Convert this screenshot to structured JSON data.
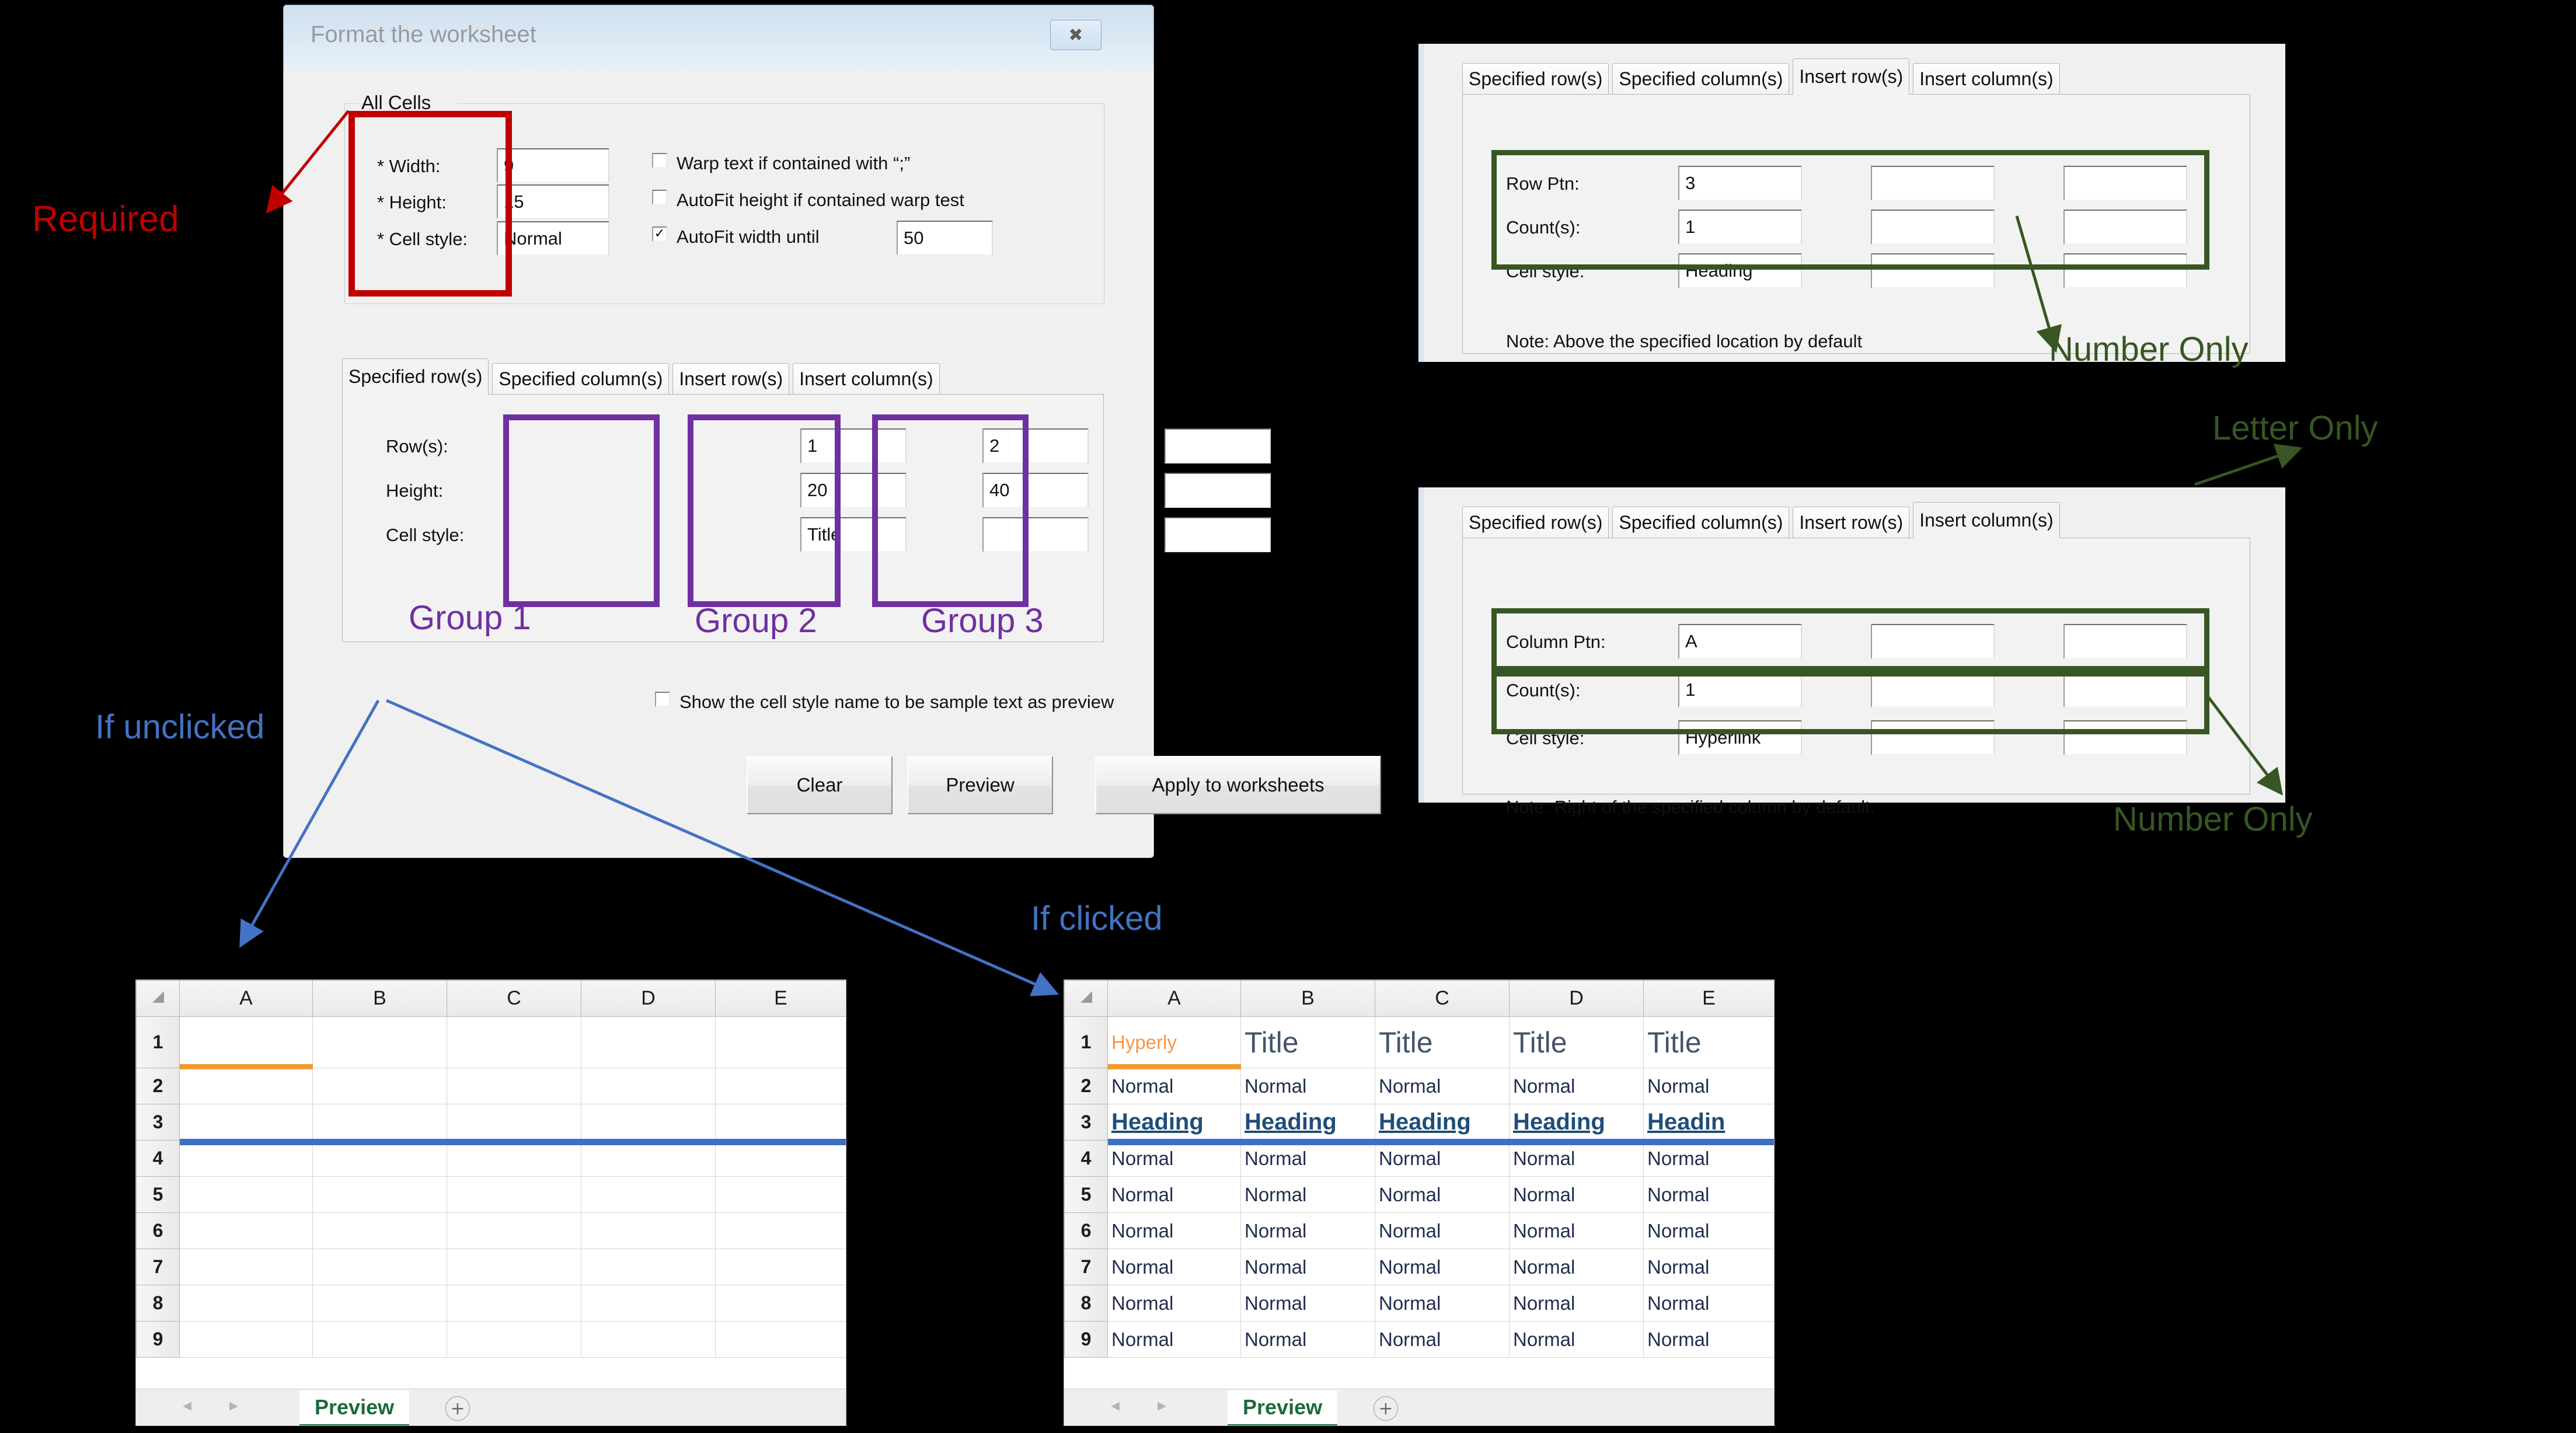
{
  "dialog": {
    "title": "Format the worksheet",
    "close_icon": "close-icon",
    "all_cells": {
      "group_label": "All Cells",
      "fields": [
        {
          "label": "* Width:",
          "value": "9"
        },
        {
          "label": "* Height:",
          "value": "15"
        },
        {
          "label": "* Cell style:",
          "value": "Normal"
        }
      ],
      "checkboxes": [
        {
          "label": "Warp text if contained with “;”",
          "checked": false
        },
        {
          "label": "AutoFit height if contained warp test",
          "checked": false
        },
        {
          "label": "AutoFit width until",
          "checked": true
        }
      ],
      "autofit_width_value": "50"
    },
    "tabs": [
      "Specified row(s)",
      "Specified column(s)",
      "Insert row(s)",
      "Insert column(s)"
    ],
    "active_tab": "Specified row(s)",
    "specified_rows": {
      "row_labels": [
        "Row(s):",
        "Height:",
        "Cell style:"
      ],
      "groups": [
        {
          "name": "Group 1",
          "values": [
            "1",
            "20",
            "Title"
          ]
        },
        {
          "name": "Group 2",
          "values": [
            "2",
            "40",
            ""
          ]
        },
        {
          "name": "Group 3",
          "values": [
            "",
            "",
            ""
          ]
        }
      ]
    },
    "preview_checkbox": {
      "label": "Show the cell style name to be sample text as preview",
      "checked": false
    },
    "buttons": [
      "Clear",
      "Preview",
      "Apply to worksheets"
    ]
  },
  "insert_rows_panel": {
    "tabs": [
      "Specified row(s)",
      "Specified column(s)",
      "Insert row(s)",
      "Insert column(s)"
    ],
    "active_tab": "Insert row(s)",
    "row_labels": [
      "Row Ptn:",
      "Count(s):",
      "Cell style:"
    ],
    "groups": [
      {
        "values": [
          "3",
          "1",
          "Heading"
        ]
      },
      {
        "values": [
          "",
          "",
          ""
        ]
      },
      {
        "values": [
          "",
          "",
          ""
        ]
      }
    ],
    "note": "Note: Above the specified location by default"
  },
  "insert_columns_panel": {
    "tabs": [
      "Specified row(s)",
      "Specified column(s)",
      "Insert row(s)",
      "Insert column(s)"
    ],
    "active_tab": "Insert column(s)",
    "row_labels": [
      "Column Ptn:",
      "Count(s):",
      "Cell style:"
    ],
    "groups": [
      {
        "values": [
          "A",
          "1",
          "Hyperlink"
        ]
      },
      {
        "values": [
          "",
          "",
          ""
        ]
      },
      {
        "values": [
          "",
          "",
          ""
        ]
      }
    ],
    "note": "Note: Right of the specified column by default."
  },
  "annotations": {
    "required": "Required",
    "group1": "Group 1",
    "group2": "Group 2",
    "group3": "Group 3",
    "if_unclicked": "If unclicked",
    "if_clicked": "If clicked",
    "number_only_top": "Number Only",
    "letter_only": "Letter Only",
    "number_only_bottom": "Number Only",
    "colors": {
      "required": "#C00000",
      "group": "#7030A0",
      "blue": "#4472C4",
      "green": "#375623"
    }
  },
  "sheet_unclicked": {
    "columns": [
      "A",
      "B",
      "C",
      "D",
      "E"
    ],
    "rows": [
      "1",
      "2",
      "3",
      "4",
      "5",
      "6",
      "7",
      "8",
      "9"
    ],
    "cells": [
      [
        "",
        "",
        "",
        "",
        ""
      ],
      [
        "",
        "",
        "",
        "",
        ""
      ],
      [
        "",
        "",
        "",
        "",
        ""
      ],
      [
        "",
        "",
        "",
        "",
        ""
      ],
      [
        "",
        "",
        "",
        "",
        ""
      ],
      [
        "",
        "",
        "",
        "",
        ""
      ],
      [
        "",
        "",
        "",
        "",
        ""
      ],
      [
        "",
        "",
        "",
        "",
        ""
      ],
      [
        "",
        "",
        "",
        "",
        ""
      ]
    ],
    "sheet_tab": "Preview",
    "add_sheet_icon": "plus-circle-icon",
    "nav_prev_icon": "chevron-left-icon",
    "nav_next_icon": "chevron-right-icon",
    "underline_row1_color": "#ED9B33",
    "underline_row3_color": "#3F6FC4"
  },
  "sheet_clicked": {
    "columns": [
      "A",
      "B",
      "C",
      "D",
      "E"
    ],
    "rows": [
      "1",
      "2",
      "3",
      "4",
      "5",
      "6",
      "7",
      "8",
      "9"
    ],
    "cells": [
      [
        "Hyperly",
        "Title",
        "Title",
        "Title",
        "Title"
      ],
      [
        "Normal",
        "Normal",
        "Normal",
        "Normal",
        "Normal"
      ],
      [
        "Heading",
        "Heading",
        "Heading",
        "Heading",
        "Headin"
      ],
      [
        "Normal",
        "Normal",
        "Normal",
        "Normal",
        "Normal"
      ],
      [
        "Normal",
        "Normal",
        "Normal",
        "Normal",
        "Normal"
      ],
      [
        "Normal",
        "Normal",
        "Normal",
        "Normal",
        "Normal"
      ],
      [
        "Normal",
        "Normal",
        "Normal",
        "Normal",
        "Normal"
      ],
      [
        "Normal",
        "Normal",
        "Normal",
        "Normal",
        "Normal"
      ],
      [
        "Normal",
        "Normal",
        "Normal",
        "Normal",
        "Normal"
      ]
    ],
    "sheet_tab": "Preview",
    "add_sheet_icon": "plus-circle-icon",
    "nav_prev_icon": "chevron-left-icon",
    "nav_next_icon": "chevron-right-icon",
    "underline_row1_color": "#ED9B33",
    "underline_row3_color": "#3F6FC4"
  }
}
